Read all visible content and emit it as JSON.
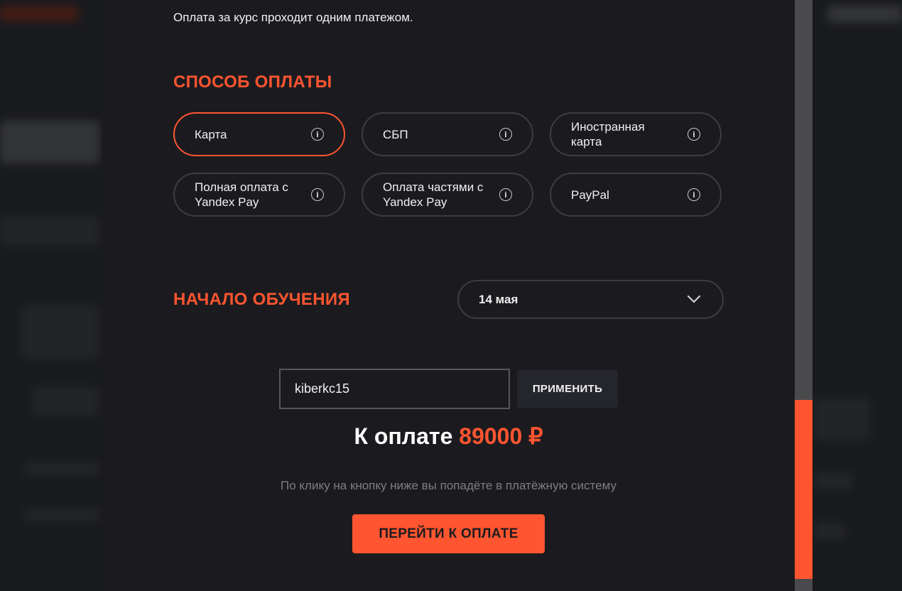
{
  "intro_text": "Оплата за курс проходит одним платежом.",
  "payment_section": {
    "title": "СПОСОБ ОПЛАТЫ",
    "methods": [
      {
        "label": "Карта",
        "selected": true
      },
      {
        "label": "СБП",
        "selected": false
      },
      {
        "label": "Иностранная карта",
        "selected": false
      },
      {
        "label": "Полная оплата с Yandex Pay",
        "selected": false
      },
      {
        "label": "Оплата частями с Yandex Pay",
        "selected": false
      },
      {
        "label": "PayPal",
        "selected": false
      }
    ],
    "info_icon_glyph": "i"
  },
  "start_section": {
    "title": "НАЧАЛО ОБУЧЕНИЯ",
    "selected_date": "14 мая"
  },
  "promo": {
    "value": "kiberkc15",
    "apply_label": "ПРИМЕНИТЬ"
  },
  "total": {
    "label": "К оплате",
    "amount": "89000 ₽"
  },
  "hint": "По клику на кнопку ниже вы попадёте в платёжную систему",
  "pay_button_label": "ПЕРЕЙТИ К ОПЛАТЕ",
  "colors": {
    "accent": "#ff5530",
    "modal_bg": "#1b1b1f",
    "border": "#3b3d44"
  }
}
